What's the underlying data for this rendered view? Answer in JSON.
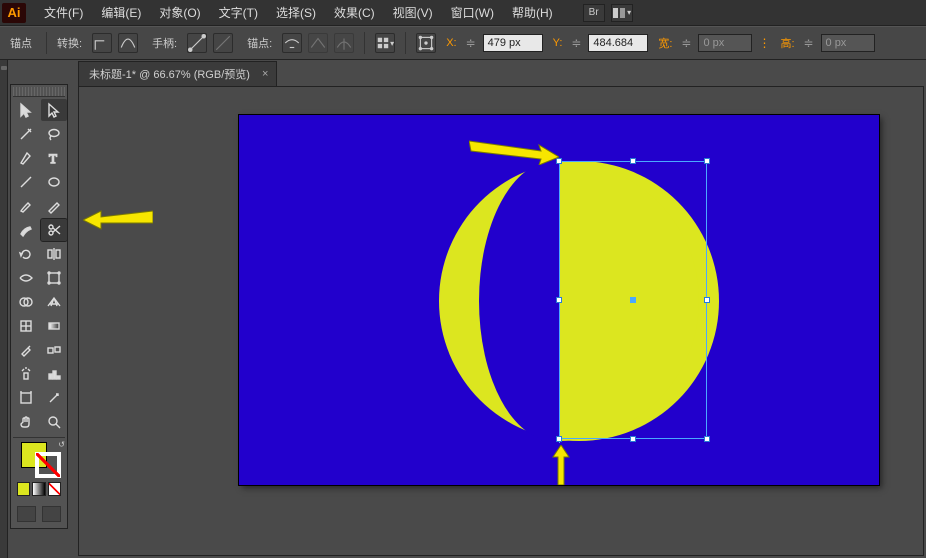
{
  "menu": {
    "file": "文件(F)",
    "edit": "编辑(E)",
    "object": "对象(O)",
    "type": "文字(T)",
    "select": "选择(S)",
    "effect": "效果(C)",
    "view": "视图(V)",
    "window": "窗口(W)",
    "help": "帮助(H)",
    "br": "Br"
  },
  "opt": {
    "anchor_label": "锚点",
    "convert_label": "转换:",
    "handle_label": "手柄:",
    "anchor2_label": "锚点:",
    "x_label": "X:",
    "x_value": "479 px",
    "y_label": "Y:",
    "y_value": "484.684",
    "w_label": "宽:",
    "w_value": "0 px",
    "h_label": "高:",
    "h_value": "0 px"
  },
  "tab": {
    "title": "未标题-1* @ 66.67% (RGB/预览)"
  }
}
